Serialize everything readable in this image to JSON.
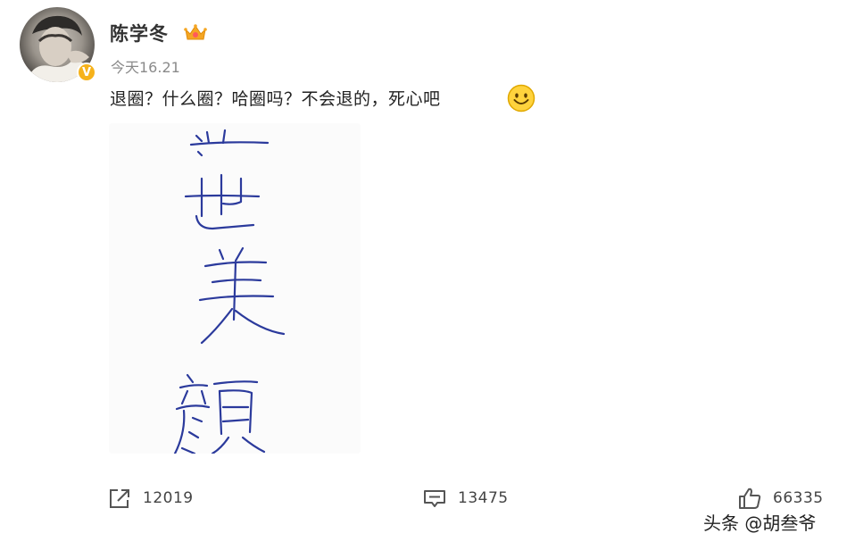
{
  "post": {
    "author": {
      "name": "陈学冬",
      "avatar": "avatar",
      "verified": true,
      "badge_icon": "crown-icon"
    },
    "timestamp": "今天16.21",
    "text": "退圈？什么圈？哈圈吗？不会退的，死心吧",
    "emoji": "smile-emoji-icon",
    "image_text": "遗世美颜",
    "actions": {
      "repost": {
        "icon": "repost-icon",
        "count": "12019"
      },
      "comment": {
        "icon": "comment-icon",
        "count": "13475"
      },
      "like": {
        "icon": "thumbs-up-icon",
        "count": "66335"
      }
    }
  },
  "watermark": "头条 @胡叁爷",
  "colors": {
    "verified": "#f6b21b",
    "text": "#222222",
    "meta": "#8a8a8a"
  }
}
